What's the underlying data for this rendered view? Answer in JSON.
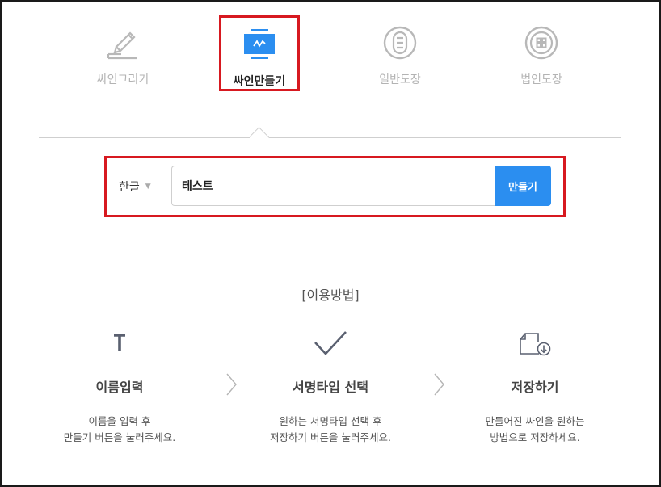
{
  "tabs": [
    {
      "label": "싸인그리기",
      "icon": "pen-sign-icon",
      "active": false
    },
    {
      "label": "싸인만들기",
      "icon": "monitor-sign-icon",
      "active": true
    },
    {
      "label": "일반도장",
      "icon": "round-stamp-icon",
      "active": false
    },
    {
      "label": "법인도장",
      "icon": "corporate-stamp-icon",
      "active": false
    }
  ],
  "form": {
    "language": "한글",
    "name_value": "테스트",
    "make_button": "만들기"
  },
  "howto": {
    "title": "[이용방법]",
    "steps": [
      {
        "icon": "text-t-icon",
        "title": "이름입력",
        "desc_line1": "이름을 입력 후",
        "desc_line2": "만들기 버튼을 눌러주세요."
      },
      {
        "icon": "checkmark-icon",
        "title": "서명타입 선택",
        "desc_line1": "원하는 서명타입 선택 후",
        "desc_line2": "저장하기 버튼을 눌러주세요."
      },
      {
        "icon": "download-file-icon",
        "title": "저장하기",
        "desc_line1": "만들어진 싸인을 원하는",
        "desc_line2": "방법으로 저장하세요."
      }
    ]
  },
  "colors": {
    "accent_blue": "#2b8ef0",
    "highlight_red": "#d71920",
    "inactive_gray": "#b3b3b3"
  }
}
